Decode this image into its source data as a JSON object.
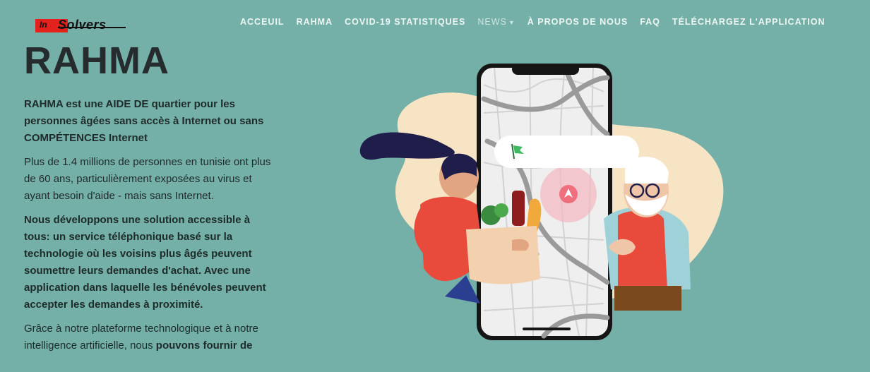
{
  "logo": {
    "prefix": "In",
    "name": "Solvers"
  },
  "nav": [
    {
      "label": "ACCEUIL"
    },
    {
      "label": "RAHMA"
    },
    {
      "label": "COVID-19 STATISTIQUES"
    },
    {
      "label": "NEWS"
    },
    {
      "label": "À PROPOS DE NOUS"
    },
    {
      "label": "FAQ"
    },
    {
      "label": "TÉLÉCHARGEZ L'APPLICATION"
    }
  ],
  "hero": {
    "title": "RAHMA",
    "para1": "RAHMA est une AIDE DE quartier pour les personnes âgées sans accès à Internet ou sans COMPÉTENCES Internet",
    "para2": "Plus de 1.4 millions de personnes en tunisie ont plus de 60 ans, particulièrement exposées au virus et ayant besoin d'aide - mais sans Internet.",
    "para3": "Nous développons une solution accessible à tous: un service téléphonique basé sur la technologie où les voisins plus âgés peuvent soumettre leurs demandes d'achat. Avec une application dans laquelle les bénévoles peuvent accepter les demandes à proximité.",
    "para4_start": "Grâce à notre plateforme technologique et à notre intelligence artificielle, nous ",
    "para4_bold": "pouvons fournir de"
  },
  "colors": {
    "background": "#74b0a8",
    "text": "#262b2d",
    "accent": "#e3211d"
  }
}
